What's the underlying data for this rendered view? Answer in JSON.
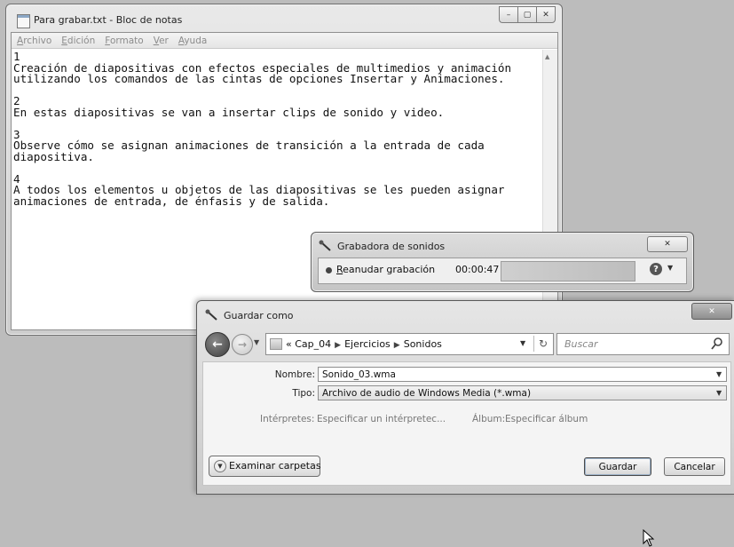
{
  "notepad": {
    "title": "Para grabar.txt - Bloc de notas",
    "menu": [
      "Archivo",
      "Edición",
      "Formato",
      "Ver",
      "Ayuda"
    ],
    "lines": [
      "1",
      "Creación de diapositivas con efectos especiales de multimedios y animación",
      "utilizando los comandos de las cintas de opciones Insertar y Animaciones.",
      "",
      "2",
      "En estas diapositivas se van a insertar clips de sonido y video.",
      "",
      "3",
      "Observe cómo se asignan animaciones de transición a la entrada de cada",
      "diapositiva.",
      "",
      "4",
      "A todos los elementos u objetos de las diapositivas se les pueden asignar",
      "animaciones de entrada, de énfasis y de salida."
    ],
    "caption": {
      "minimize": "–",
      "maximize": "▢",
      "close": "✕"
    }
  },
  "recorder": {
    "title": "Grabadora de sonidos",
    "resume_mnemonic": "R",
    "resume_rest": "eanudar grabación",
    "time": "00:00:47",
    "help": "?",
    "close": "✕"
  },
  "saveas": {
    "title": "Guardar como",
    "close": "✕",
    "breadcrumb": [
      "Cap_04",
      "Ejercicios",
      "Sonidos"
    ],
    "breadcrumb_prefix": "«",
    "search_placeholder": "Buscar",
    "name_label": "Nombre:",
    "name_value": "Sonido_03.wma",
    "type_label": "Tipo:",
    "type_value": "Archivo de audio de Windows Media (*.wma)",
    "artists_label": "Intérpretes:",
    "artists_value": "Especificar un intérpretec...",
    "album_label": "Álbum:",
    "album_value": "Especificar álbum",
    "browse_label": "Examinar carpetas",
    "save_button": "Guardar",
    "cancel_button": "Cancelar"
  }
}
